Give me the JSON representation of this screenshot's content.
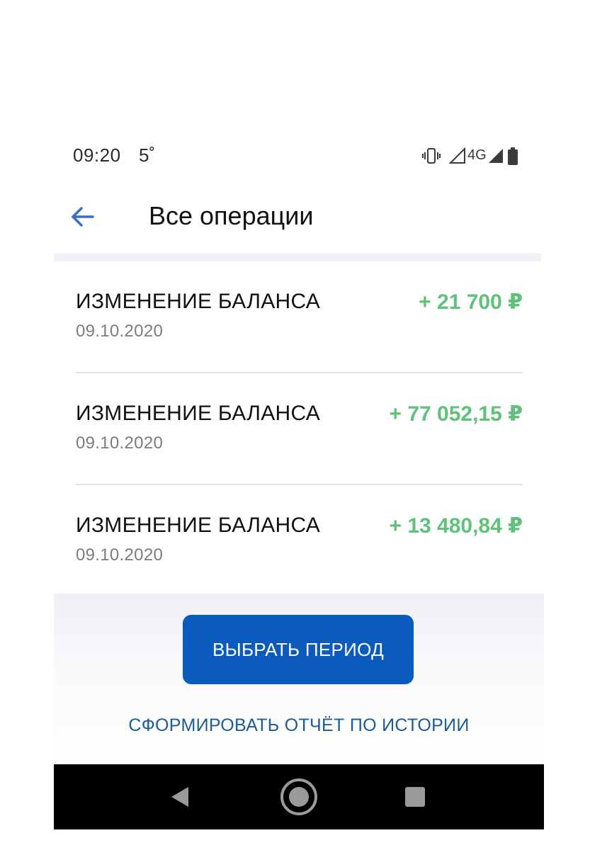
{
  "status_bar": {
    "time": "09:20",
    "temperature": "5˚",
    "network": "4G",
    "icons": [
      "vibrate-icon",
      "signal-icon",
      "signal-icon",
      "battery-icon"
    ]
  },
  "header": {
    "title": "Все операции",
    "back_icon": "arrow-left-icon"
  },
  "operations": [
    {
      "title": "ИЗМЕНЕНИЕ БАЛАНСА",
      "date": "09.10.2020",
      "amount": "+ 21 700 ₽"
    },
    {
      "title": "ИЗМЕНЕНИЕ БАЛАНСА",
      "date": "09.10.2020",
      "amount": "+ 77 052,15 ₽"
    },
    {
      "title": "ИЗМЕНЕНИЕ БАЛАНСА",
      "date": "09.10.2020",
      "amount": "+ 13 480,84 ₽"
    }
  ],
  "actions": {
    "select_period": "ВЫБРАТЬ ПЕРИОД",
    "history_report": "СФОРМИРОВАТЬ ОТЧЁТ ПО ИСТОРИИ"
  },
  "nav_bar": {
    "icons": [
      "nav-back-icon",
      "nav-home-icon",
      "nav-recents-icon"
    ]
  },
  "colors": {
    "accent": "#0a5bbd",
    "amount_positive": "#5fc17a",
    "link": "#1d5b99",
    "back_arrow": "#3c6cc7"
  }
}
